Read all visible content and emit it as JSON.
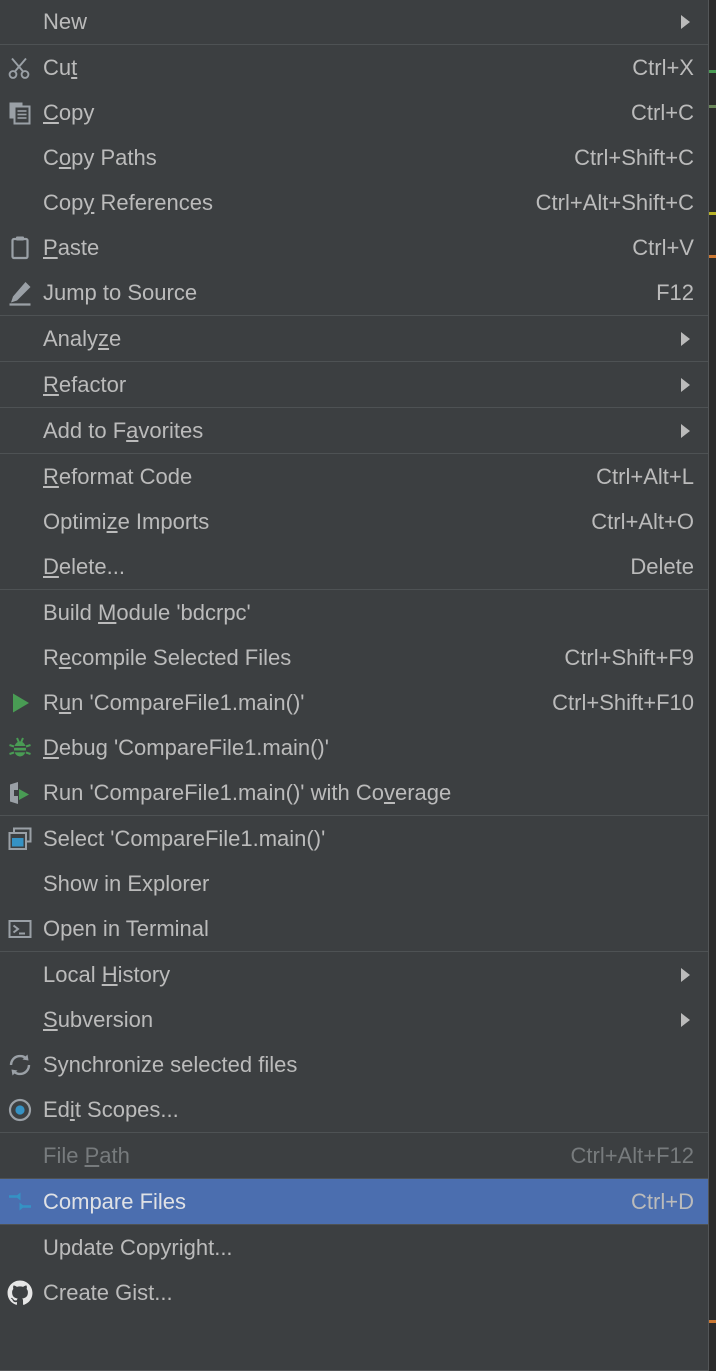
{
  "theme": {
    "menu_background": "#3c3f41",
    "separator": "#4e5254",
    "text": "#bbbbbb",
    "disabled_text": "#777b7d",
    "selection_background": "#4b6eaf",
    "selection_text": "#dfe1e5",
    "accent_green": "#499c54",
    "accent_cyan": "#3592c4",
    "editor_background": "#2b2b2b"
  },
  "context_menu": {
    "name": "project-view-context-menu",
    "sections": [
      {
        "name": "new-section",
        "items": [
          {
            "name": "new",
            "label": "New",
            "mnemonic": "",
            "shortcut": "",
            "icon": "",
            "submenu": true,
            "disabled": false,
            "selected": false,
            "partial": true
          }
        ]
      },
      {
        "name": "clipboard-section",
        "items": [
          {
            "name": "cut",
            "label": "Cut",
            "label_pre": "Cu",
            "mnemonic": "t",
            "label_post": "",
            "shortcut": "Ctrl+X",
            "icon": "scissors-icon",
            "submenu": false,
            "disabled": false,
            "selected": false
          },
          {
            "name": "copy",
            "label": "Copy",
            "label_pre": "",
            "mnemonic": "C",
            "label_post": "opy",
            "shortcut": "Ctrl+C",
            "icon": "copy-icon",
            "submenu": false,
            "disabled": false,
            "selected": false
          },
          {
            "name": "copy-paths",
            "label": "Copy Paths",
            "label_pre": "C",
            "mnemonic": "o",
            "label_post": "py Paths",
            "shortcut": "Ctrl+Shift+C",
            "icon": "",
            "submenu": false,
            "disabled": false,
            "selected": false
          },
          {
            "name": "copy-references",
            "label": "Copy References",
            "label_pre": "Cop",
            "mnemonic": "y",
            "label_post": " References",
            "shortcut": "Ctrl+Alt+Shift+C",
            "icon": "",
            "submenu": false,
            "disabled": false,
            "selected": false
          },
          {
            "name": "paste",
            "label": "Paste",
            "label_pre": "",
            "mnemonic": "P",
            "label_post": "aste",
            "shortcut": "Ctrl+V",
            "icon": "clipboard-icon",
            "submenu": false,
            "disabled": false,
            "selected": false
          },
          {
            "name": "jump-to-source",
            "label": "Jump to Source",
            "label_pre": "Jump to Source",
            "mnemonic": "",
            "label_post": "",
            "shortcut": "F12",
            "icon": "pencil-icon",
            "submenu": false,
            "disabled": false,
            "selected": false
          }
        ]
      },
      {
        "name": "analyze-section",
        "items": [
          {
            "name": "analyze",
            "label": "Analyze",
            "label_pre": "Analy",
            "mnemonic": "z",
            "label_post": "e",
            "shortcut": "",
            "icon": "",
            "submenu": true,
            "disabled": false,
            "selected": false
          }
        ]
      },
      {
        "name": "refactor-section",
        "items": [
          {
            "name": "refactor",
            "label": "Refactor",
            "label_pre": "",
            "mnemonic": "R",
            "label_post": "efactor",
            "shortcut": "",
            "icon": "",
            "submenu": true,
            "disabled": false,
            "selected": false
          }
        ]
      },
      {
        "name": "favorites-section",
        "items": [
          {
            "name": "add-to-favorites",
            "label": "Add to Favorites",
            "label_pre": "Add to F",
            "mnemonic": "a",
            "label_post": "vorites",
            "shortcut": "",
            "icon": "",
            "submenu": true,
            "disabled": false,
            "selected": false
          }
        ]
      },
      {
        "name": "code-section",
        "items": [
          {
            "name": "reformat-code",
            "label": "Reformat Code",
            "label_pre": "",
            "mnemonic": "R",
            "label_post": "eformat Code",
            "shortcut": "Ctrl+Alt+L",
            "icon": "",
            "submenu": false,
            "disabled": false,
            "selected": false
          },
          {
            "name": "optimize-imports",
            "label": "Optimize Imports",
            "label_pre": "Optimi",
            "mnemonic": "z",
            "label_post": "e Imports",
            "shortcut": "Ctrl+Alt+O",
            "icon": "",
            "submenu": false,
            "disabled": false,
            "selected": false
          },
          {
            "name": "delete",
            "label": "Delete...",
            "label_pre": "",
            "mnemonic": "D",
            "label_post": "elete...",
            "shortcut": "Delete",
            "icon": "",
            "submenu": false,
            "disabled": false,
            "selected": false
          }
        ]
      },
      {
        "name": "build-run-section",
        "items": [
          {
            "name": "build-module",
            "label": "Build Module 'bdcrpc'",
            "label_pre": "Build ",
            "mnemonic": "M",
            "label_post": "odule 'bdcrpc'",
            "shortcut": "",
            "icon": "",
            "submenu": false,
            "disabled": false,
            "selected": false
          },
          {
            "name": "recompile-selected-files",
            "label": "Recompile Selected Files",
            "label_pre": "R",
            "mnemonic": "e",
            "label_post": "compile Selected Files",
            "shortcut": "Ctrl+Shift+F9",
            "icon": "",
            "submenu": false,
            "disabled": false,
            "selected": false
          },
          {
            "name": "run-comparefile1-main",
            "label": "Run 'CompareFile1.main()'",
            "label_pre": "R",
            "mnemonic": "u",
            "label_post": "n 'CompareFile1.main()'",
            "shortcut": "Ctrl+Shift+F10",
            "icon": "run-icon",
            "submenu": false,
            "disabled": false,
            "selected": false
          },
          {
            "name": "debug-comparefile1-main",
            "label": "Debug 'CompareFile1.main()'",
            "label_pre": "",
            "mnemonic": "D",
            "label_post": "ebug 'CompareFile1.main()'",
            "shortcut": "",
            "icon": "debug-icon",
            "submenu": false,
            "disabled": false,
            "selected": false
          },
          {
            "name": "run-with-coverage",
            "label": "Run 'CompareFile1.main()' with Coverage",
            "label_pre": "Run 'CompareFile1.main()' with Co",
            "mnemonic": "v",
            "label_post": "erage",
            "shortcut": "",
            "icon": "coverage-icon",
            "submenu": false,
            "disabled": false,
            "selected": false
          }
        ]
      },
      {
        "name": "select-show-section",
        "items": [
          {
            "name": "select-comparefile1-main",
            "label": "Select 'CompareFile1.main()'",
            "label_pre": "Select 'CompareFile1.main()'",
            "mnemonic": "",
            "label_post": "",
            "shortcut": "",
            "icon": "select-window-icon",
            "submenu": false,
            "disabled": false,
            "selected": false
          },
          {
            "name": "show-in-explorer",
            "label": "Show in Explorer",
            "label_pre": "Show in Explorer",
            "mnemonic": "",
            "label_post": "",
            "shortcut": "",
            "icon": "",
            "submenu": false,
            "disabled": false,
            "selected": false
          },
          {
            "name": "open-in-terminal",
            "label": "Open in Terminal",
            "label_pre": "Open in Terminal",
            "mnemonic": "",
            "label_post": "",
            "shortcut": "",
            "icon": "terminal-icon",
            "submenu": false,
            "disabled": false,
            "selected": false
          }
        ]
      },
      {
        "name": "vcs-section",
        "items": [
          {
            "name": "local-history",
            "label": "Local History",
            "label_pre": "Local ",
            "mnemonic": "H",
            "label_post": "istory",
            "shortcut": "",
            "icon": "",
            "submenu": true,
            "disabled": false,
            "selected": false
          },
          {
            "name": "subversion",
            "label": "Subversion",
            "label_pre": "",
            "mnemonic": "S",
            "label_post": "ubversion",
            "shortcut": "",
            "icon": "",
            "submenu": true,
            "disabled": false,
            "selected": false
          },
          {
            "name": "synchronize-selected-files",
            "label": "Synchronize selected files",
            "label_pre": "Synchronize selected files",
            "mnemonic": "",
            "label_post": "",
            "shortcut": "",
            "icon": "sync-icon",
            "submenu": false,
            "disabled": false,
            "selected": false
          },
          {
            "name": "edit-scopes",
            "label": "Edit Scopes...",
            "label_pre": "Ed",
            "mnemonic": "i",
            "label_post": "t Scopes...",
            "shortcut": "",
            "icon": "scope-icon",
            "submenu": false,
            "disabled": false,
            "selected": false
          }
        ]
      },
      {
        "name": "file-path-section",
        "items": [
          {
            "name": "file-path",
            "label": "File Path",
            "label_pre": "File ",
            "mnemonic": "P",
            "label_post": "ath",
            "shortcut": "Ctrl+Alt+F12",
            "icon": "",
            "submenu": false,
            "disabled": true,
            "selected": false
          }
        ]
      },
      {
        "name": "compare-section",
        "items": [
          {
            "name": "compare-files",
            "label": "Compare Files",
            "label_pre": "Compare Files",
            "mnemonic": "",
            "label_post": "",
            "shortcut": "Ctrl+D",
            "icon": "compare-icon",
            "submenu": false,
            "disabled": false,
            "selected": true
          }
        ]
      },
      {
        "name": "misc-section",
        "items": [
          {
            "name": "update-copyright",
            "label": "Update Copyright...",
            "label_pre": "Update Copyright...",
            "mnemonic": "",
            "label_post": "",
            "shortcut": "",
            "icon": "",
            "submenu": false,
            "disabled": false,
            "selected": false
          },
          {
            "name": "create-gist",
            "label": "Create Gist...",
            "label_pre": "Create Gist...",
            "mnemonic": "",
            "label_post": "",
            "shortcut": "",
            "icon": "github-icon",
            "submenu": false,
            "disabled": false,
            "selected": false
          }
        ]
      }
    ]
  }
}
